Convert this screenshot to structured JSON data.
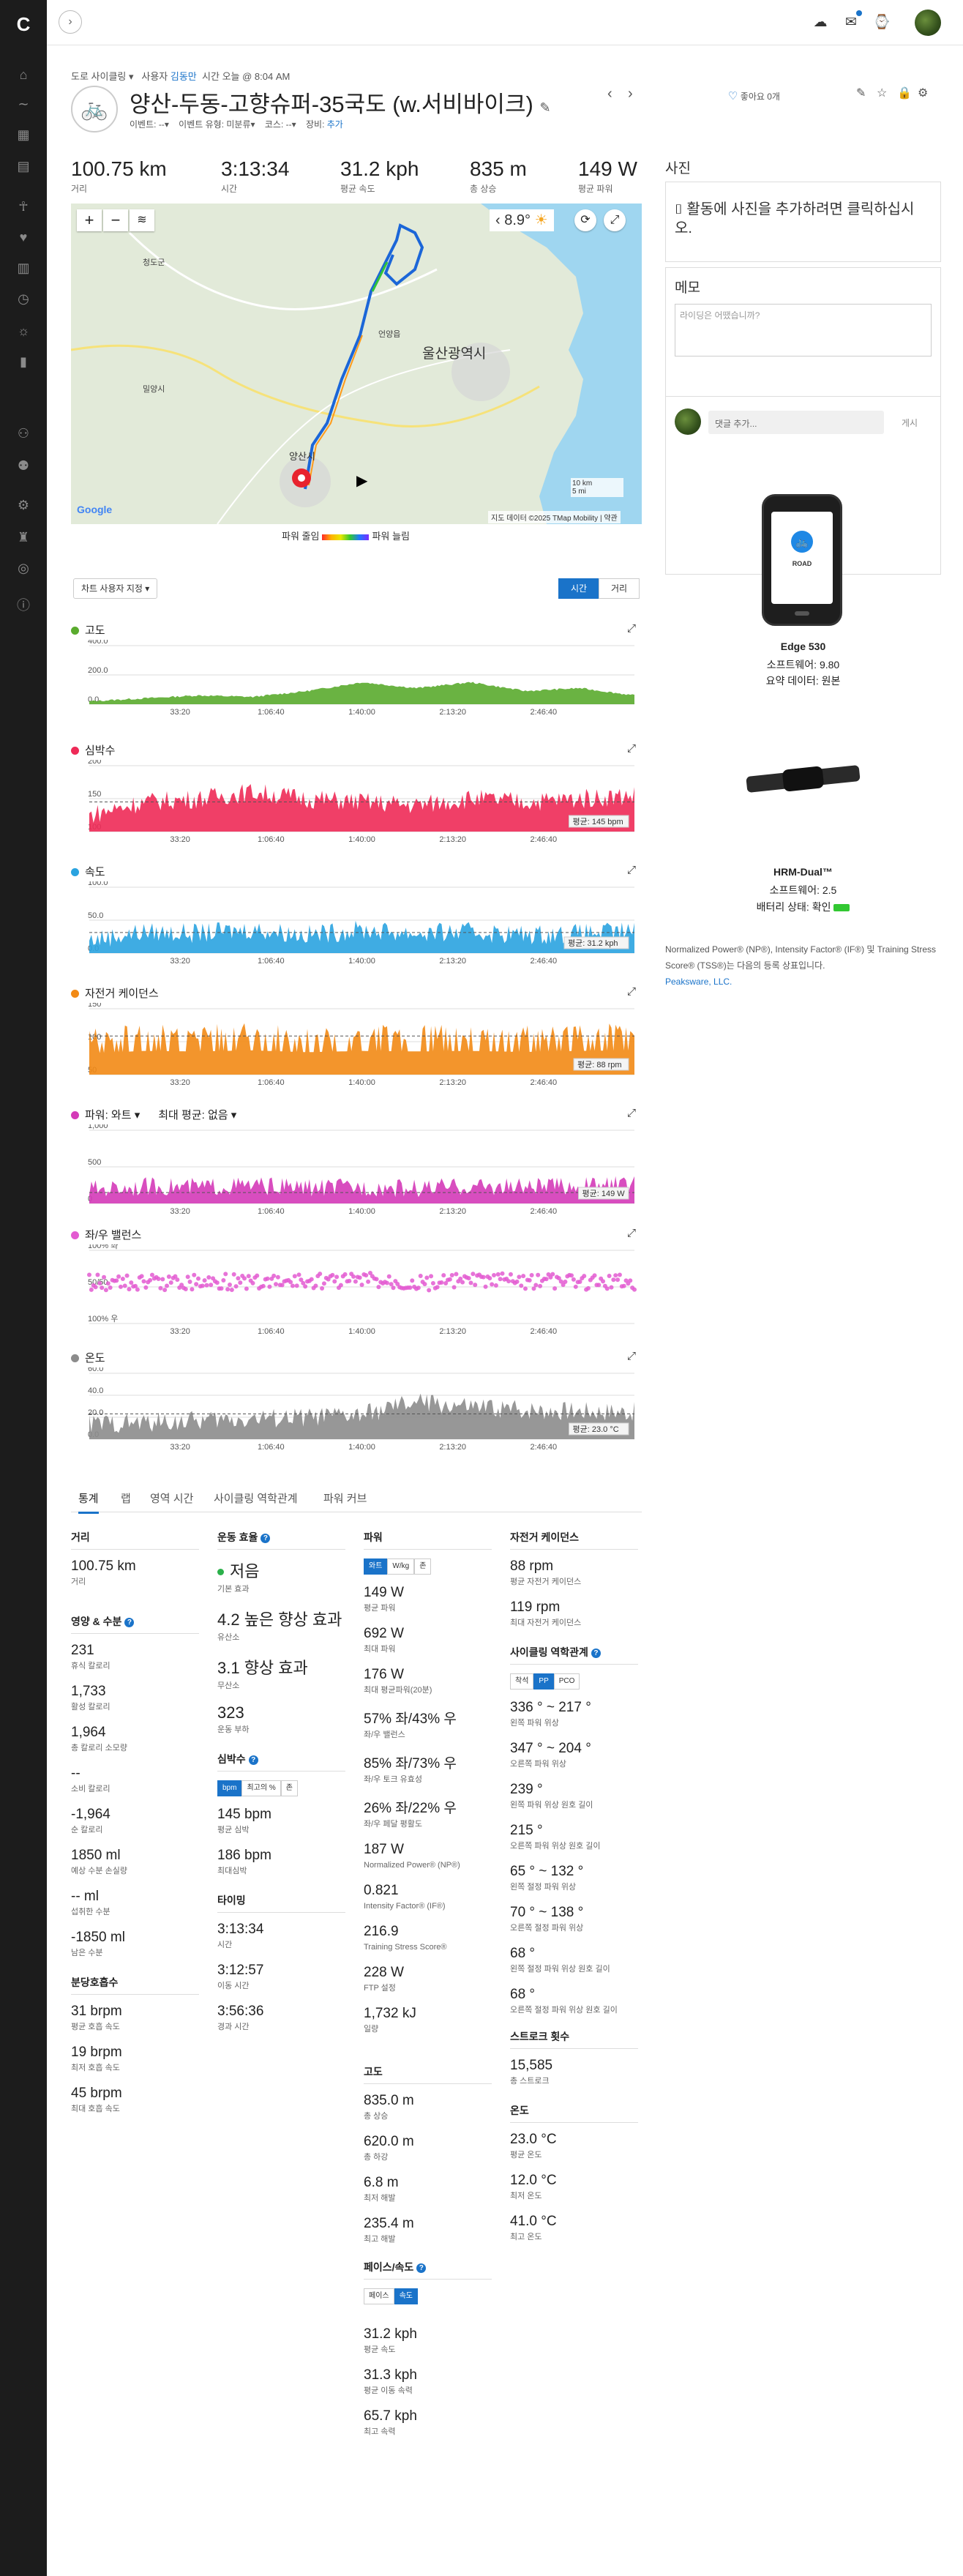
{
  "sidebar": {
    "icons": [
      "garmin-logo-icon",
      "home-icon",
      "activity-wave-icon",
      "calendar-icon",
      "news-icon",
      "running-person-icon",
      "heart-icon",
      "bar-chart-icon",
      "stopwatch-icon",
      "lightbulb-icon",
      "reports-icon",
      "group-icon",
      "people-icon",
      "gear-icon",
      "trophy-icon",
      "target-icon",
      "info-icon"
    ]
  },
  "topbar": {
    "expand_icon": "chevron-right-icon",
    "icons": [
      "cloud-upload-icon",
      "inbox-icon",
      "watch-icon"
    ]
  },
  "breadcrumb": {
    "activity_type": "도로 사이클링",
    "by_label": "사용자",
    "user": "김동만",
    "time_label": "시간",
    "time_value": "오늘 @ 8:04 AM"
  },
  "activity": {
    "title": "양산-두동-고향슈퍼-35국도 (w.서비바이크)",
    "event_label": "이벤트:",
    "event_value": "--",
    "event_type_label": "이벤트 유형:",
    "event_type_value": "미분류",
    "course_label": "코스:",
    "course_value": "--",
    "gear_label": "장비:",
    "gear_value": "추가",
    "likes": "좋아요 0개"
  },
  "summary": [
    {
      "value": "100.75 km",
      "label": "거리"
    },
    {
      "value": "3:13:34",
      "label": "시간"
    },
    {
      "value": "31.2 kph",
      "label": "평균 속도"
    },
    {
      "value": "835 m",
      "label": "총 상승"
    },
    {
      "value": "149 W",
      "label": "평균 파워"
    }
  ],
  "map": {
    "temperature": "8.9°",
    "city_label": "울산광역시",
    "start_label": "양산시",
    "places": [
      "청도군",
      "밀양시",
      "언양읍"
    ],
    "scale_km": "10 km",
    "scale_mi": "5 mi",
    "attribution": "지도 데이터 ©2025 TMap Mobility",
    "terms": "약관",
    "google": "Google",
    "legend_low": "파워 줄임",
    "legend_high": "파워 늘림"
  },
  "chart_controls": {
    "custom_label": "차트 사용자 지정",
    "time": "시간",
    "distance": "거리"
  },
  "chart_data": [
    {
      "type": "area",
      "title": "고도",
      "color": "#5aab2e",
      "x_ticks": [
        "33:20",
        "1:06:40",
        "1:40:00",
        "2:13:20",
        "2:46:40"
      ],
      "y_ticks": [
        "400.0",
        "200.0",
        "0.0"
      ],
      "ylim": [
        0,
        400
      ],
      "x": [
        0,
        10,
        20,
        30,
        40,
        50,
        60,
        70,
        80,
        90,
        100
      ],
      "values": [
        20,
        40,
        60,
        50,
        90,
        150,
        110,
        150,
        90,
        110,
        60
      ]
    },
    {
      "type": "area",
      "title": "심박수",
      "color": "#ee2a57",
      "x_ticks": [
        "33:20",
        "1:06:40",
        "1:40:00",
        "2:13:20",
        "2:46:40"
      ],
      "y_ticks": [
        "200",
        "150",
        "100"
      ],
      "ylim": [
        100,
        200
      ],
      "x": [
        0,
        10,
        20,
        30,
        40,
        50,
        60,
        70,
        80,
        90,
        100
      ],
      "values": [
        125,
        145,
        150,
        160,
        150,
        145,
        140,
        150,
        145,
        150,
        155
      ],
      "average_label": "평균: 145 bpm",
      "average": 145
    },
    {
      "type": "area",
      "title": "속도",
      "color": "#2aa3e0",
      "x_ticks": [
        "33:20",
        "1:06:40",
        "1:40:00",
        "2:13:20",
        "2:46:40"
      ],
      "y_ticks": [
        "100.0",
        "50.0",
        "0.0"
      ],
      "ylim": [
        0,
        100
      ],
      "x": [
        0,
        10,
        20,
        30,
        40,
        50,
        60,
        70,
        80,
        90,
        100
      ],
      "values": [
        20,
        32,
        30,
        36,
        28,
        35,
        30,
        32,
        28,
        30,
        33
      ],
      "average_label": "평균: 31.2 kph",
      "average": 31.2
    },
    {
      "type": "area",
      "title": "자전거 케이던스",
      "color": "#f28a15",
      "x_ticks": [
        "33:20",
        "1:06:40",
        "1:40:00",
        "2:13:20",
        "2:46:40"
      ],
      "y_ticks": [
        "150",
        "100",
        "50"
      ],
      "ylim": [
        0,
        150
      ],
      "x": [
        0,
        10,
        20,
        30,
        40,
        50,
        60,
        70,
        80,
        90,
        100
      ],
      "values": [
        80,
        90,
        88,
        92,
        85,
        90,
        88,
        90,
        86,
        90,
        92
      ],
      "average_label": "평균: 88 rpm",
      "average": 88
    },
    {
      "type": "area",
      "title": "파워: 와트",
      "extra_label": "최대 평균: 없음",
      "color": "#d43ab8",
      "x_ticks": [
        "33:20",
        "1:06:40",
        "1:40:00",
        "2:13:20",
        "2:46:40"
      ],
      "y_ticks": [
        "1,000",
        "500",
        "0"
      ],
      "ylim": [
        0,
        1000
      ],
      "x": [
        0,
        10,
        20,
        30,
        40,
        50,
        60,
        70,
        80,
        90,
        100
      ],
      "values": [
        120,
        160,
        150,
        170,
        140,
        150,
        130,
        160,
        150,
        170,
        180
      ],
      "average_label": "평균: 149 W",
      "average": 149
    },
    {
      "type": "scatter",
      "title": "좌/우 밸런스",
      "color": "#e35ad1",
      "x_ticks": [
        "33:20",
        "1:06:40",
        "1:40:00",
        "2:13:20",
        "2:46:40"
      ],
      "y_ticks": [
        "100% 좌",
        "50/50",
        "100% 우"
      ],
      "ylim": [
        0,
        100
      ],
      "x": [
        0,
        10,
        20,
        30,
        40,
        50,
        60,
        70,
        80,
        90,
        100
      ],
      "values": [
        57,
        55,
        58,
        56,
        57,
        59,
        56,
        57,
        58,
        56,
        57
      ]
    },
    {
      "type": "area",
      "title": "온도",
      "color": "#8c8c8c",
      "x_ticks": [
        "33:20",
        "1:06:40",
        "1:40:00",
        "2:13:20",
        "2:46:40"
      ],
      "y_ticks": [
        "60.0",
        "40.0",
        "20.0",
        "0.0"
      ],
      "ylim": [
        0,
        60
      ],
      "x": [
        0,
        10,
        20,
        30,
        40,
        50,
        60,
        70,
        80,
        90,
        100
      ],
      "values": [
        14,
        15,
        17,
        19,
        20,
        22,
        34,
        29,
        27,
        26,
        25
      ],
      "average_label": "평균: 23.0 °C",
      "average": 23
    }
  ],
  "tabs": [
    "통계",
    "랩",
    "영역 시간",
    "사이클링 역학관계",
    "파워 커브"
  ],
  "stats": {
    "distance": {
      "title": "거리",
      "value": "100.75 km",
      "label": "거리"
    },
    "nutrition": {
      "title": "영양 & 수분",
      "items": [
        {
          "value": "231",
          "label": "휴식 칼로리"
        },
        {
          "value": "1,733",
          "label": "활성 칼로리"
        },
        {
          "value": "1,964",
          "label": "총 칼로리 소모량"
        },
        {
          "value": "--",
          "label": "소비 칼로리"
        },
        {
          "value": "-1,964",
          "label": "순 칼로리"
        },
        {
          "value": "1850 ml",
          "label": "예상 수분 손실량"
        },
        {
          "value": "-- ml",
          "label": "섭취한 수분"
        },
        {
          "value": "-1850 ml",
          "label": "남은 수분"
        }
      ]
    },
    "respiration": {
      "title": "분당호흡수",
      "items": [
        {
          "value": "31 brpm",
          "label": "평균 호흡 속도"
        },
        {
          "value": "19 brpm",
          "label": "최저 호흡 속도"
        },
        {
          "value": "45 brpm",
          "label": "최대 호흡 속도"
        }
      ]
    },
    "training_effect": {
      "title": "운동 효율",
      "items": [
        {
          "value": "저음",
          "label": "기본 효과"
        },
        {
          "value": "4.2 높은 향상 효과",
          "label": "유산소"
        },
        {
          "value": "3.1 향상 효과",
          "label": "무산소"
        },
        {
          "value": "323",
          "label": "운동 부하"
        }
      ]
    },
    "heart_rate": {
      "title": "심박수",
      "toggles": [
        "bpm",
        "최고의 %",
        "존"
      ],
      "items": [
        {
          "value": "145 bpm",
          "label": "평균 심박"
        },
        {
          "value": "186 bpm",
          "label": "최대심박"
        }
      ]
    },
    "timing": {
      "title": "타이밍",
      "items": [
        {
          "value": "3:13:34",
          "label": "시간"
        },
        {
          "value": "3:12:57",
          "label": "이동 시간"
        },
        {
          "value": "3:56:36",
          "label": "경과 시간"
        }
      ]
    },
    "power": {
      "title": "파워",
      "toggles": [
        "와트",
        "W/kg",
        "존"
      ],
      "items": [
        {
          "value": "149 W",
          "label": "평균 파워"
        },
        {
          "value": "692 W",
          "label": "최대 파워"
        },
        {
          "value": "176 W",
          "label": "최대 평균파워(20분)"
        },
        {
          "value": "57% 좌/43% 우",
          "label": "좌/우 밸런스"
        },
        {
          "value": "85% 좌/73% 우",
          "label": "좌/우 토크 유효성"
        },
        {
          "value": "26% 좌/22% 우",
          "label": "좌/우 페달 평활도"
        },
        {
          "value": "187 W",
          "label": "Normalized Power® (NP®)"
        },
        {
          "value": "0.821",
          "label": "Intensity Factor® (IF®)"
        },
        {
          "value": "216.9",
          "label": "Training Stress Score®"
        },
        {
          "value": "228 W",
          "label": "FTP 설정"
        },
        {
          "value": "1,732 kJ",
          "label": "일량"
        }
      ]
    },
    "elevation": {
      "title": "고도",
      "items": [
        {
          "value": "835.0 m",
          "label": "총 상승"
        },
        {
          "value": "620.0 m",
          "label": "총 하강"
        },
        {
          "value": "6.8 m",
          "label": "최저 해발"
        },
        {
          "value": "235.4 m",
          "label": "최고 해발"
        }
      ]
    },
    "pace_speed": {
      "title": "페이스/속도",
      "toggles": [
        "페이스",
        "속도"
      ],
      "items": [
        {
          "value": "31.2 kph",
          "label": "평균 속도"
        },
        {
          "value": "31.3 kph",
          "label": "평균 이동 속력"
        },
        {
          "value": "65.7 kph",
          "label": "최고 속력"
        }
      ]
    },
    "cadence": {
      "title": "자전거 케이던스",
      "items": [
        {
          "value": "88 rpm",
          "label": "평균 자전거 케이던스"
        },
        {
          "value": "119 rpm",
          "label": "최대 자전거 케이던스"
        }
      ]
    },
    "dynamics": {
      "title": "사이클링 역학관계",
      "toggles": [
        "착석",
        "PP",
        "PCO"
      ],
      "items": [
        {
          "value": "336 ° ~ 217 °",
          "label": "왼쪽 파워 위상"
        },
        {
          "value": "347 ° ~ 204 °",
          "label": "오른쪽 파워 위상"
        },
        {
          "value": "239 °",
          "label": "왼쪽 파워 위상 원호 길이"
        },
        {
          "value": "215 °",
          "label": "오른쪽 파워 위상 원호 길이"
        },
        {
          "value": "65 ° ~ 132 °",
          "label": "왼쪽 절정 파워 위상"
        },
        {
          "value": "70 ° ~ 138 °",
          "label": "오른쪽 절정 파워 위상"
        },
        {
          "value": "68 °",
          "label": "왼쪽 절정 파워 위상 원호 길이"
        },
        {
          "value": "68 °",
          "label": "오른쪽 절정 파워 위상 원호 길이"
        }
      ]
    },
    "strokes": {
      "title": "스트로크 횟수",
      "value": "15,585",
      "label": "총 스트로크"
    },
    "temperature": {
      "title": "온도",
      "items": [
        {
          "value": "23.0 °C",
          "label": "평균 온도"
        },
        {
          "value": "12.0 °C",
          "label": "최저 온도"
        },
        {
          "value": "41.0 °C",
          "label": "최고 온도"
        }
      ]
    }
  },
  "right": {
    "photos_title": "사진",
    "photos_add": "활동에 사진을 추가하려면 클릭하십시오.",
    "notes_title": "메모",
    "notes_placeholder": "라이딩은 어땠습니까?",
    "comment_placeholder": "댓글 추가...",
    "comment_post": "게시",
    "device1_name": "Edge 530",
    "device1_sw": "소프트웨어: 9.80",
    "device1_data": "요약 데이터: 원본",
    "device2_name": "HRM-Dual™",
    "device2_sw": "소프트웨어: 2.5",
    "device2_battery": "배터리 상태: 확인",
    "fineprint": "Normalized Power® (NP®), Intensity Factor® (IF®) 및 Training Stress Score® (TSS®)는 다음의 등록 상표입니다.",
    "fineprint_link": "Peaksware, LLC."
  }
}
